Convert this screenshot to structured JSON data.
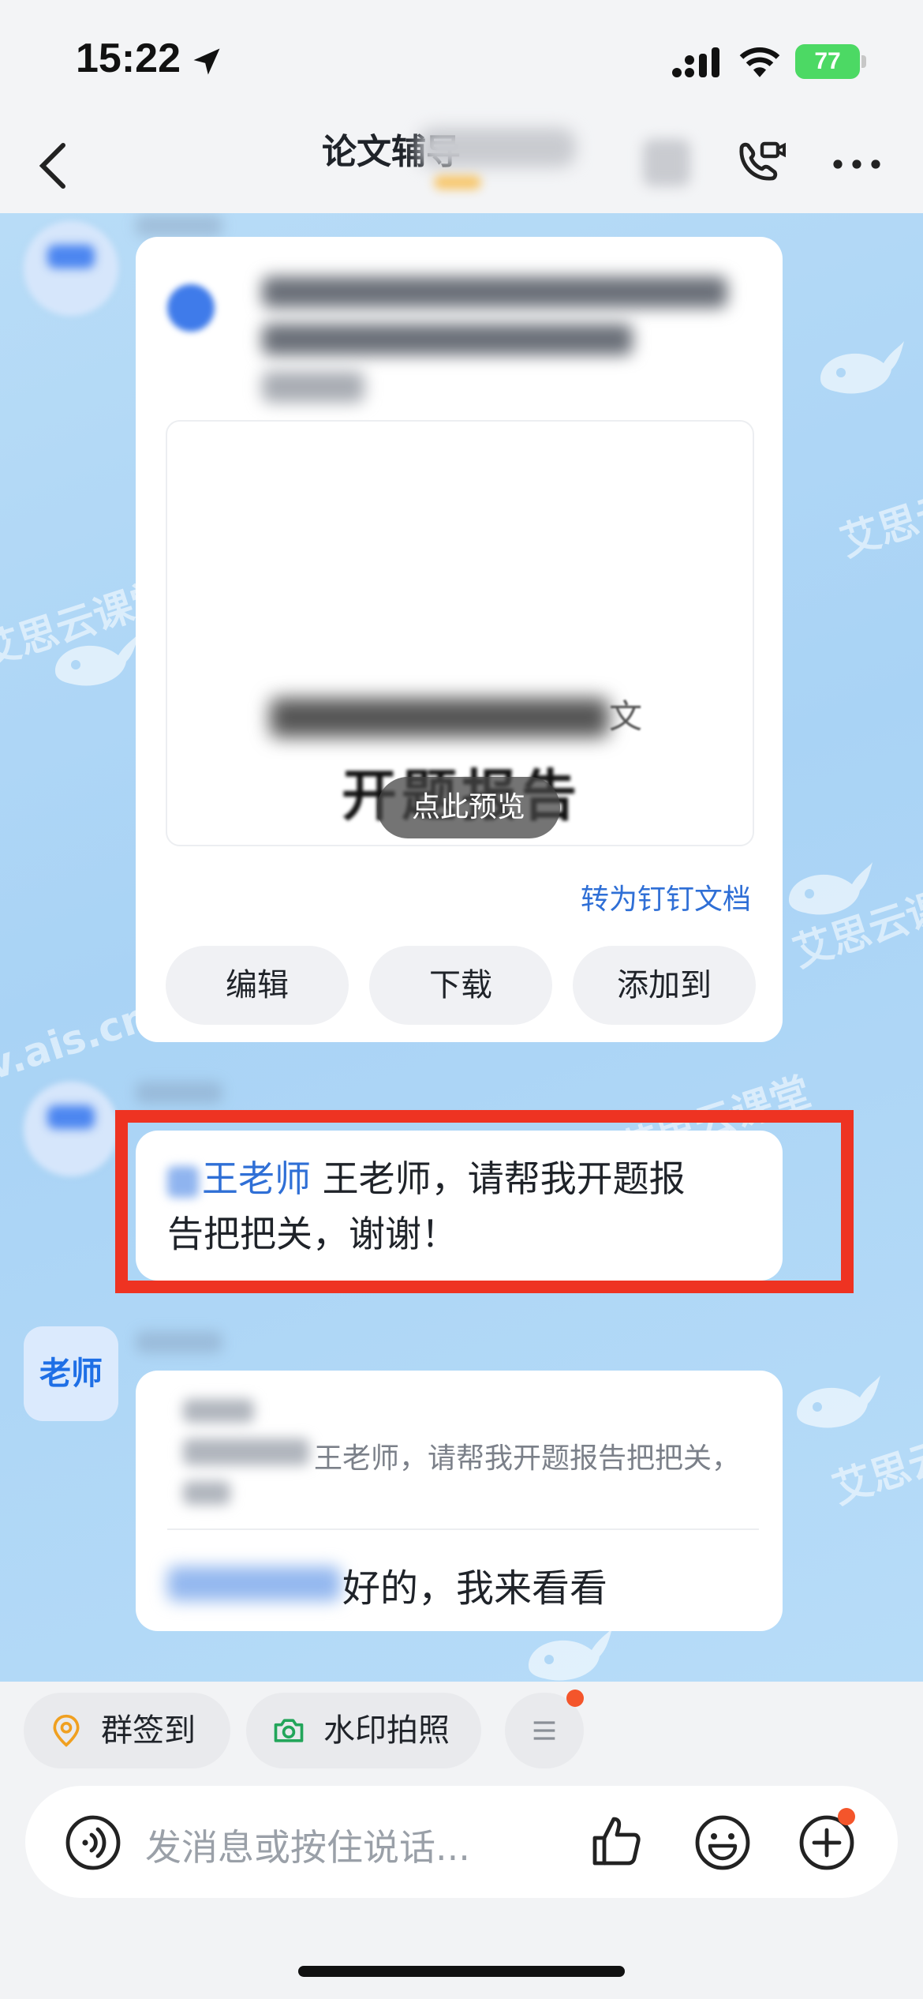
{
  "status_bar": {
    "time": "15:22",
    "battery": "77"
  },
  "header": {
    "title": "论文辅导"
  },
  "file_card": {
    "preview_title_end": "文",
    "preview_doc_title": "开题报告",
    "preview_badge": "点此预览",
    "convert_link": "转为钉钉文档",
    "buttons": {
      "edit": "编辑",
      "download": "下载",
      "add_to": "添加到"
    }
  },
  "message": {
    "mention": "王老师",
    "line1_rest": " 王老师，请帮我开题报",
    "line2": "告把把关，谢谢！"
  },
  "reply": {
    "sender_avatar": "老师",
    "quote": "王老师，请帮我开题报告把把关，",
    "text": "好的，我来看看"
  },
  "quick_actions": {
    "check_in": "群签到",
    "watermark_photo": "水印拍照"
  },
  "input": {
    "placeholder": "发消息或按住说话..."
  },
  "watermark": {
    "brand": "艾思云课堂",
    "url": "v.ais.cn"
  },
  "colors": {
    "accent": "#2f6fd6",
    "highlight_box": "#ee3322",
    "chat_bg": "#b0d7f6"
  }
}
